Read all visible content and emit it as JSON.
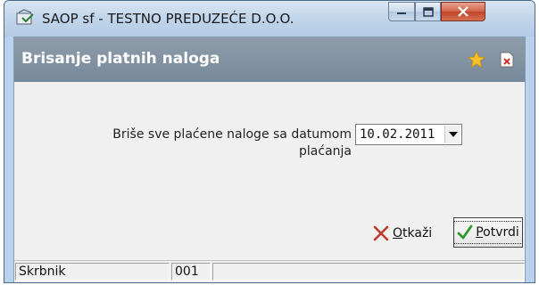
{
  "window": {
    "title": "SAOP sf - TESTNO PREDUZEĆE D.O.O."
  },
  "dialog": {
    "title": "Brisanje platnih naloga",
    "header_icons": [
      "star-icon",
      "close-document-icon"
    ]
  },
  "form": {
    "label_line1": "Briše sve plaćene naloge sa datumom",
    "label_line2": "plaćanja",
    "date_value": "10.02.2011"
  },
  "buttons": {
    "cancel_mnemonic": "O",
    "cancel_rest": "tkaži",
    "confirm_mnemonic": "P",
    "confirm_rest": "otvrdi"
  },
  "statusbar": {
    "user": "Skrbnik",
    "code": "001",
    "extra": ""
  },
  "colors": {
    "header_bg": "#7f91a3",
    "window_frame": "#b9d1ea",
    "close_button": "#c0432a",
    "cancel_x": "#c0392b",
    "confirm_check": "#2e9a2e"
  }
}
